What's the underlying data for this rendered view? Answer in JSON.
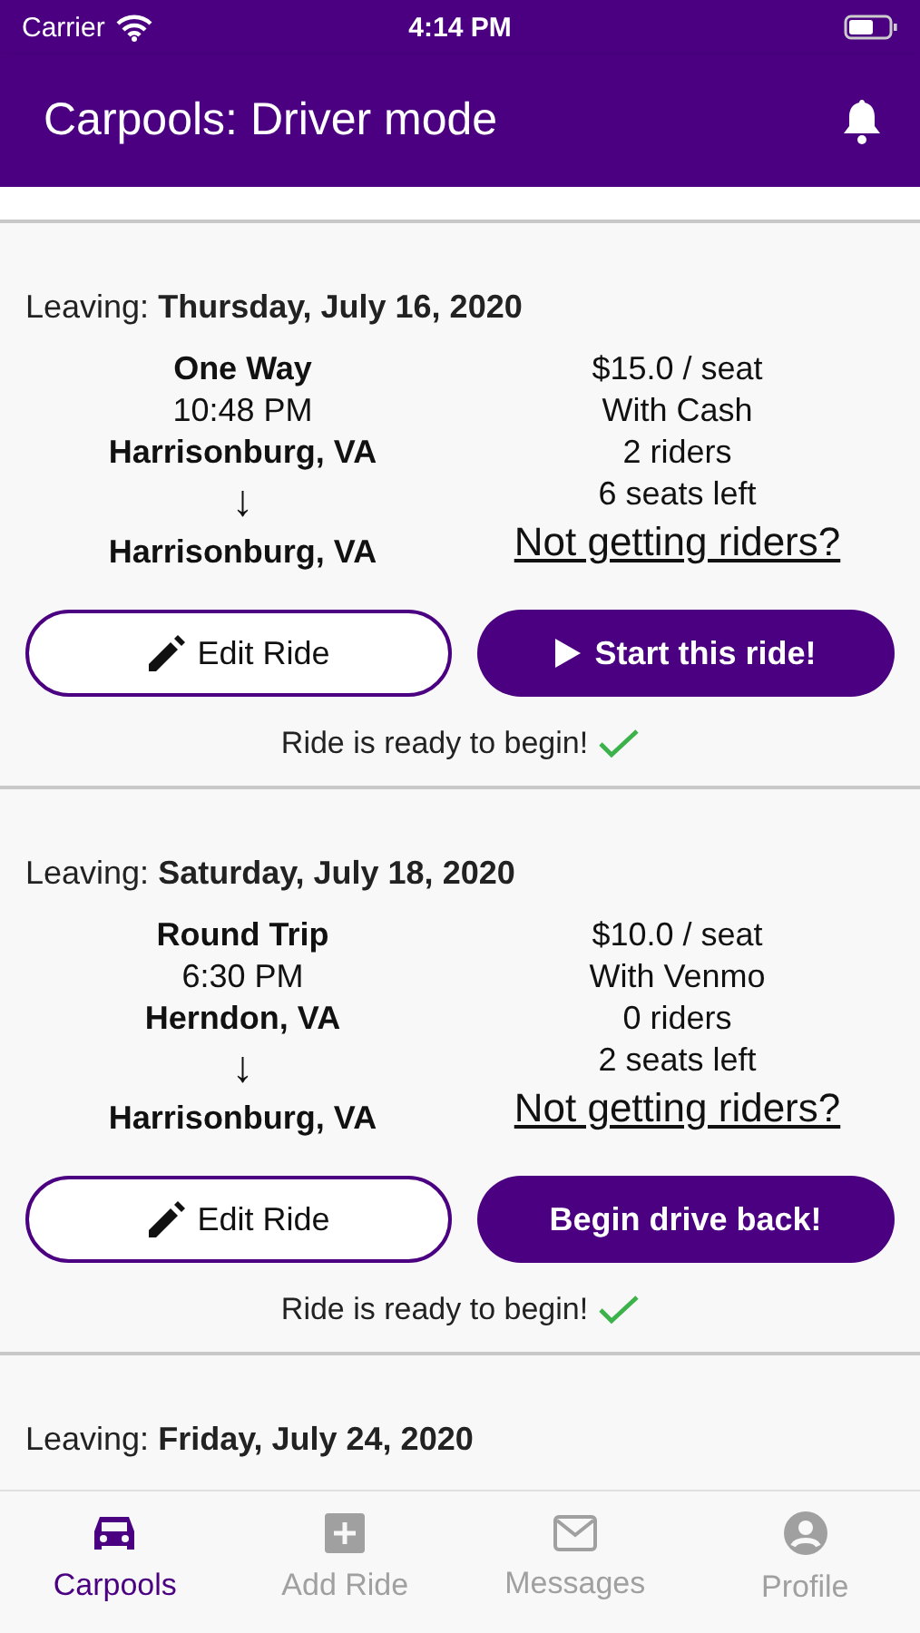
{
  "status_bar": {
    "carrier": "Carrier",
    "time": "4:14 PM"
  },
  "app_bar": {
    "title": "Carpools: Driver mode"
  },
  "rides": [
    {
      "leaving_label": "Leaving:",
      "date": "Thursday, July 16, 2020",
      "trip_type": "One Way",
      "time": "10:48 PM",
      "from": "Harrisonburg, VA",
      "arrow": "↓",
      "to": "Harrisonburg, VA",
      "price": "$15.0 / seat",
      "payment": "With Cash",
      "riders": "2 riders",
      "seats_left": "6 seats left",
      "link": "Not getting riders?",
      "edit_button": "Edit Ride",
      "action_button": {
        "kind": "play",
        "label": "Start this ride!"
      },
      "status": "Ride is ready to begin!",
      "ready": true
    },
    {
      "leaving_label": "Leaving:",
      "date": "Saturday, July 18, 2020",
      "trip_type": "Round Trip",
      "time": "6:30 PM",
      "from": "Herndon, VA",
      "arrow": "↓",
      "to": "Harrisonburg, VA",
      "price": "$10.0 / seat",
      "payment": "With Venmo",
      "riders": "0 riders",
      "seats_left": "2 seats left",
      "link": "Not getting riders?",
      "edit_button": "Edit Ride",
      "action_button": {
        "kind": "plain",
        "label": "Begin drive back!"
      },
      "status": "Ride is ready to begin!",
      "ready": true
    },
    {
      "leaving_label": "Leaving:",
      "date": "Friday, July 24, 2020"
    }
  ],
  "tabs": [
    {
      "label": "Carpools",
      "kind": "car",
      "selected": true
    },
    {
      "label": "Add Ride",
      "kind": "add",
      "selected": false
    },
    {
      "label": "Messages",
      "kind": "mail",
      "selected": false
    },
    {
      "label": "Profile",
      "kind": "profile",
      "selected": false
    }
  ]
}
